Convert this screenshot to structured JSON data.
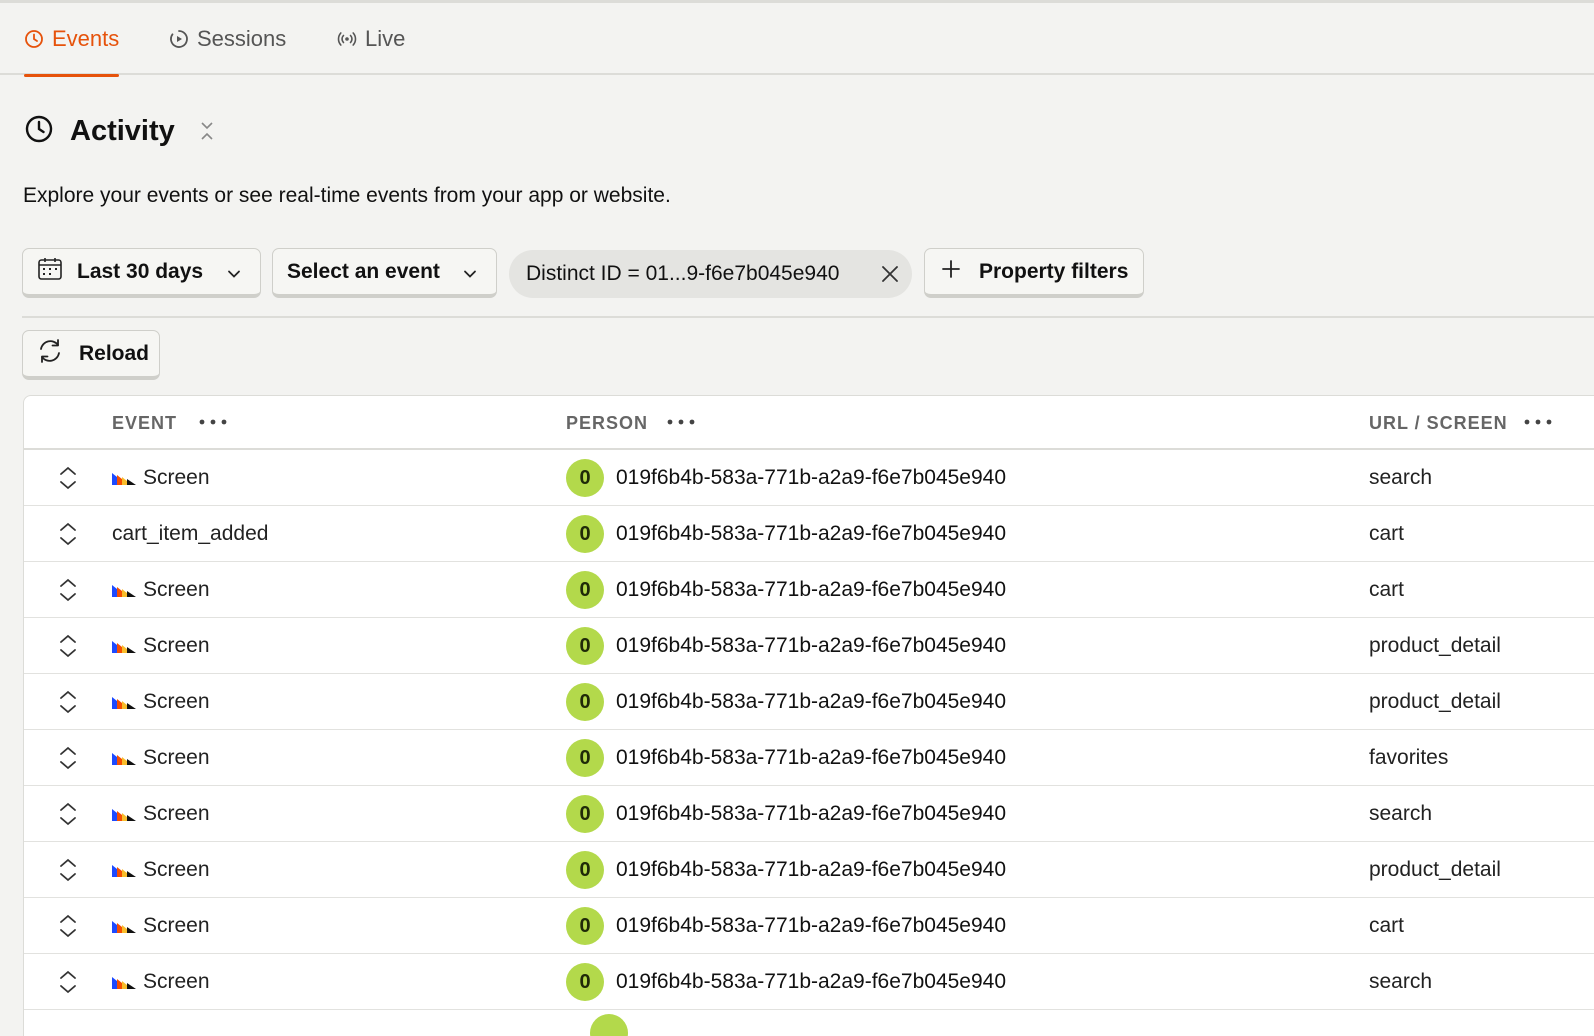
{
  "tabs": [
    {
      "label": "Events",
      "icon": "clock-icon",
      "active": true
    },
    {
      "label": "Sessions",
      "icon": "play-circle-icon",
      "active": false
    },
    {
      "label": "Live",
      "icon": "broadcast-icon",
      "active": false
    }
  ],
  "header": {
    "title": "Activity",
    "subtitle": "Explore your events or see real-time events from your app or website."
  },
  "filters": {
    "date_range": "Last 30 days",
    "event_select": "Select an event",
    "active_filter": "Distinct ID = 01...9-f6e7b045e940",
    "property_filters": "Property filters",
    "reload": "Reload"
  },
  "table": {
    "columns": [
      "EVENT",
      "PERSON",
      "URL / SCREEN"
    ],
    "rows": [
      {
        "event": "Screen",
        "has_logo": true,
        "avatar": "0",
        "person": "019f6b4b-583a-771b-a2a9-f6e7b045e940",
        "url": "search"
      },
      {
        "event": "cart_item_added",
        "has_logo": false,
        "avatar": "0",
        "person": "019f6b4b-583a-771b-a2a9-f6e7b045e940",
        "url": "cart"
      },
      {
        "event": "Screen",
        "has_logo": true,
        "avatar": "0",
        "person": "019f6b4b-583a-771b-a2a9-f6e7b045e940",
        "url": "cart"
      },
      {
        "event": "Screen",
        "has_logo": true,
        "avatar": "0",
        "person": "019f6b4b-583a-771b-a2a9-f6e7b045e940",
        "url": "product_detail"
      },
      {
        "event": "Screen",
        "has_logo": true,
        "avatar": "0",
        "person": "019f6b4b-583a-771b-a2a9-f6e7b045e940",
        "url": "product_detail"
      },
      {
        "event": "Screen",
        "has_logo": true,
        "avatar": "0",
        "person": "019f6b4b-583a-771b-a2a9-f6e7b045e940",
        "url": "favorites"
      },
      {
        "event": "Screen",
        "has_logo": true,
        "avatar": "0",
        "person": "019f6b4b-583a-771b-a2a9-f6e7b045e940",
        "url": "search"
      },
      {
        "event": "Screen",
        "has_logo": true,
        "avatar": "0",
        "person": "019f6b4b-583a-771b-a2a9-f6e7b045e940",
        "url": "product_detail"
      },
      {
        "event": "Screen",
        "has_logo": true,
        "avatar": "0",
        "person": "019f6b4b-583a-771b-a2a9-f6e7b045e940",
        "url": "cart"
      },
      {
        "event": "Screen",
        "has_logo": true,
        "avatar": "0",
        "person": "019f6b4b-583a-771b-a2a9-f6e7b045e940",
        "url": "search"
      }
    ]
  },
  "colors": {
    "accent": "#e6520b",
    "avatar": "#b3d94b",
    "background": "#f3f3f1"
  }
}
